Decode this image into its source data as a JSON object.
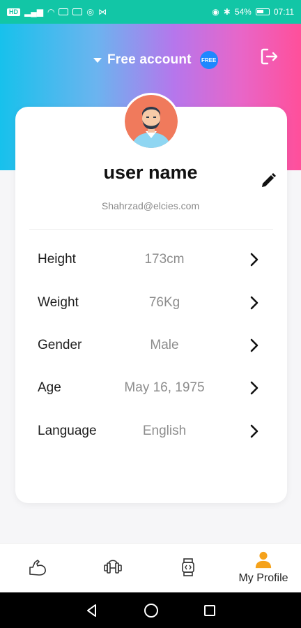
{
  "status_bar": {
    "left_badge": "HD",
    "battery": "54%",
    "time": "07:11"
  },
  "header": {
    "account_label": "Free account",
    "account_badge": "FREE"
  },
  "profile": {
    "name": "user name",
    "email": "Shahrzad@elcies.com"
  },
  "fields": [
    {
      "label": "Height",
      "value": "173cm"
    },
    {
      "label": "Weight",
      "value": "76Kg"
    },
    {
      "label": "Gender",
      "value": "Male"
    },
    {
      "label": "Age",
      "value": "May 16, 1975"
    },
    {
      "label": "Language",
      "value": "English"
    }
  ],
  "bottom_nav": {
    "items": [
      {
        "icon": "muscle-arm-icon",
        "label": ""
      },
      {
        "icon": "dumbbell-icon",
        "label": ""
      },
      {
        "icon": "smartwatch-icon",
        "label": ""
      },
      {
        "icon": "profile-icon",
        "label": "My Profile",
        "active": true
      }
    ]
  },
  "colors": {
    "accent_badge": "#1e88ff",
    "active_nav": "#f5a21b",
    "header_gradient_start": "#17c1ec",
    "header_gradient_end": "#ff4f9a"
  }
}
